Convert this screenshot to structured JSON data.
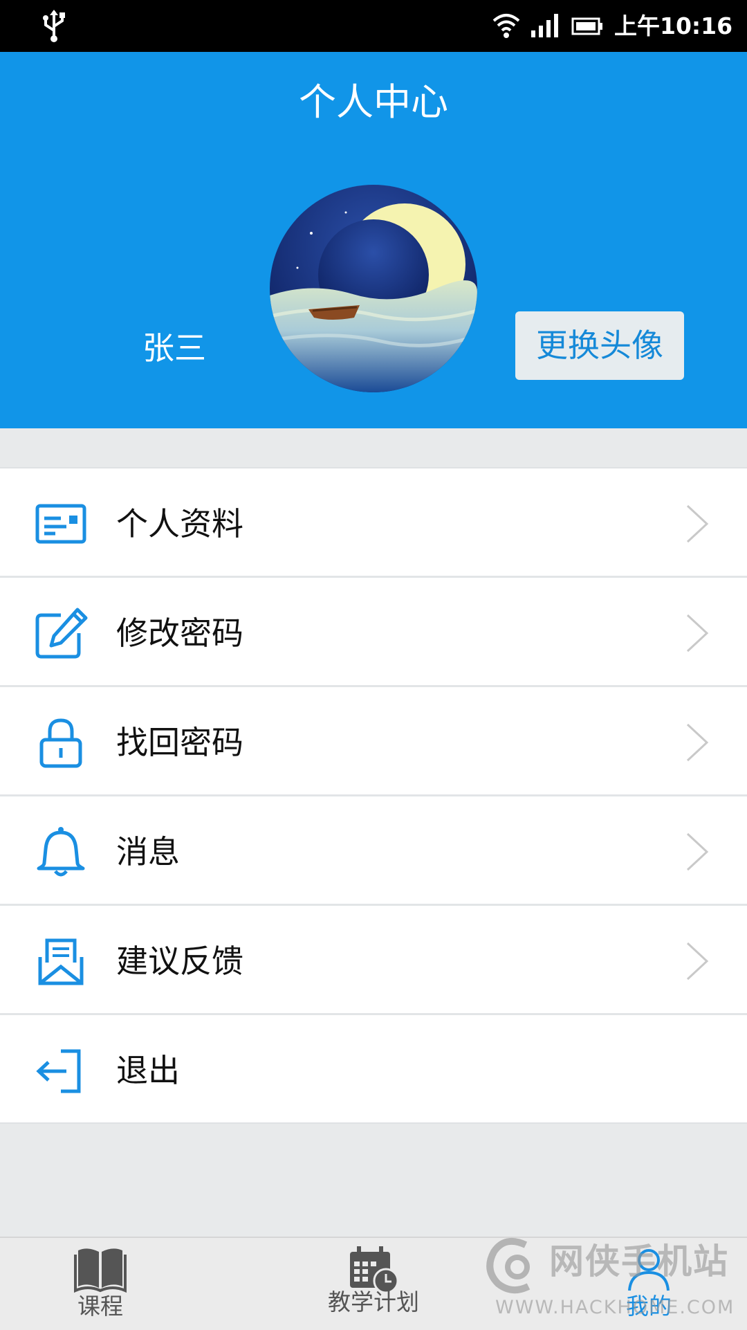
{
  "status_bar": {
    "time": "上午10:16",
    "icons": [
      "usb-icon",
      "wifi-icon",
      "signal-icon",
      "battery-icon"
    ]
  },
  "header": {
    "title": "个人中心",
    "username": "张三",
    "change_avatar_label": "更换头像",
    "background_color": "#1195e8"
  },
  "menu": {
    "items": [
      {
        "label": "个人资料",
        "icon": "profile-card-icon",
        "has_chevron": true
      },
      {
        "label": "修改密码",
        "icon": "edit-icon",
        "has_chevron": true
      },
      {
        "label": "找回密码",
        "icon": "lock-icon",
        "has_chevron": true
      },
      {
        "label": "消息",
        "icon": "bell-icon",
        "has_chevron": true
      },
      {
        "label": "建议反馈",
        "icon": "feedback-mail-icon",
        "has_chevron": true
      },
      {
        "label": "退出",
        "icon": "logout-icon",
        "has_chevron": false
      }
    ],
    "icon_color": "#1a8fe2"
  },
  "bottom_nav": {
    "items": [
      {
        "label": "课程",
        "icon": "book-icon",
        "active": false
      },
      {
        "label": "教学计划",
        "icon": "calendar-clock-icon",
        "active": false
      },
      {
        "label": "我的",
        "icon": "user-icon",
        "active": true
      }
    ],
    "active_color": "#1a8fe2"
  },
  "watermark": {
    "text": "网侠手机站",
    "url": "WWW.HACKHOME.COM"
  }
}
